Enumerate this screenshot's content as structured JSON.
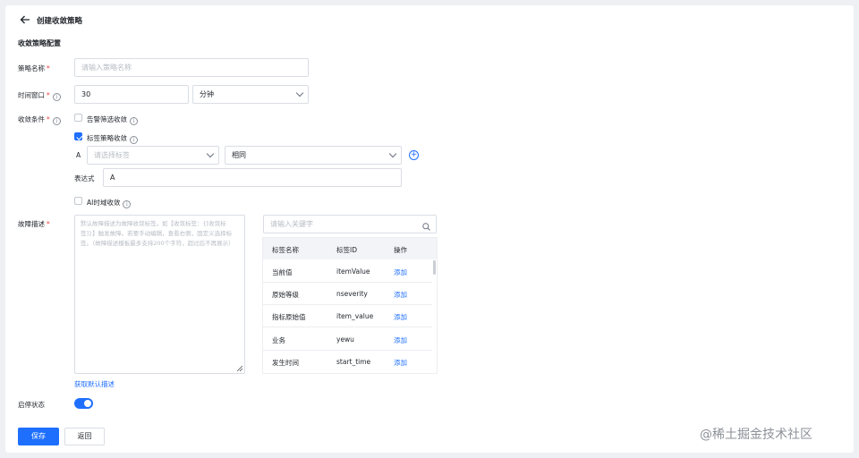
{
  "header": {
    "back_icon": "arrow-left-icon",
    "title": "创建收敛策略"
  },
  "section_title": "收敛策略配置",
  "strategy_name": {
    "label": "策略名称",
    "required": "*",
    "placeholder": "请输入策略名称"
  },
  "time_window": {
    "label": "时间窗口",
    "required": "*",
    "value": "30",
    "unit": "分钟"
  },
  "conditions": {
    "label": "收敛条件",
    "required": "*",
    "alarm_filter_label": "告警筛选收敛",
    "alarm_filter_checked": false,
    "tag_strategy_label": "标签策略收敛",
    "tag_strategy_checked": true,
    "row_letter": "A",
    "tag_select_placeholder": "请选择标签",
    "operator_value": "相同",
    "expression_label": "表达式",
    "expression_value": "A",
    "ai_label": "AI时域收敛",
    "ai_checked": false
  },
  "fault_desc": {
    "label": "故障描述",
    "required": "*",
    "placeholder": "默认故障描述为故障收敛标签。如【收敛标签：{[收敛标签]}】触发故障。若要手动编辑，查看右侧，固定义选择标签。（故障描述模板最多支持200个字符，超过后不再展示）",
    "default_link": "获取默认描述"
  },
  "tag_panel": {
    "search_placeholder": "请输入关键字",
    "columns": [
      "标签名称",
      "标签ID",
      "操作"
    ],
    "rows": [
      {
        "name": "当前值",
        "id": "itemValue",
        "action": "添加"
      },
      {
        "name": "原始等级",
        "id": "nseverity",
        "action": "添加"
      },
      {
        "name": "指标原始值",
        "id": "item_value",
        "action": "添加"
      },
      {
        "name": "业务",
        "id": "yewu",
        "action": "添加"
      },
      {
        "name": "发生时间",
        "id": "start_time",
        "action": "添加"
      }
    ]
  },
  "enable_status": {
    "label": "启停状态",
    "on": true
  },
  "actions": {
    "save": "保存",
    "back": "返回"
  },
  "watermark": "@稀土掘金技术社区",
  "colors": {
    "primary": "#1f6fff",
    "required": "#f53f3f",
    "border": "#d9dde3"
  }
}
